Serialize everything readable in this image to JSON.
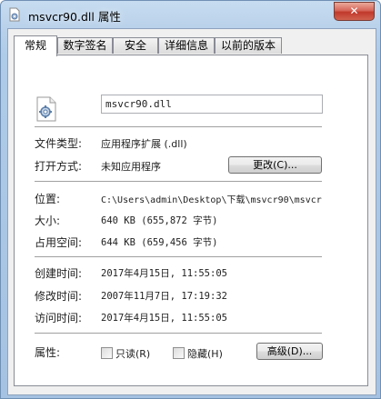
{
  "window": {
    "title": "msvcr90.dll 属性",
    "close_label": "✕"
  },
  "tabs": [
    {
      "label": "常规",
      "active": true
    },
    {
      "label": "数字签名"
    },
    {
      "label": "安全"
    },
    {
      "label": "详细信息"
    },
    {
      "label": "以前的版本"
    }
  ],
  "general": {
    "file_name": "msvcr90.dll",
    "file_type_label": "文件类型:",
    "file_type_value": "应用程序扩展 (.dll)",
    "open_with_label": "打开方式:",
    "open_with_value": "未知应用程序",
    "change_button": "更改(C)...",
    "location_label": "位置:",
    "location_value": "C:\\Users\\admin\\Desktop\\下载\\msvcr90\\msvcr",
    "size_label": "大小:",
    "size_value": "640 KB (655,872 字节)",
    "size_on_disk_label": "占用空间:",
    "size_on_disk_value": "644 KB (659,456 字节)",
    "created_label": "创建时间:",
    "created_value": "2017年4月15日, 11:55:05",
    "modified_label": "修改时间:",
    "modified_value": "2007年11月7日, 17:19:32",
    "accessed_label": "访问时间:",
    "accessed_value": "2017年4月15日, 11:55:05",
    "attributes_label": "属性:",
    "readonly_label": "只读(R)",
    "readonly_checked": false,
    "hidden_label": "隐藏(H)",
    "hidden_checked": false,
    "advanced_button": "高级(D)..."
  }
}
